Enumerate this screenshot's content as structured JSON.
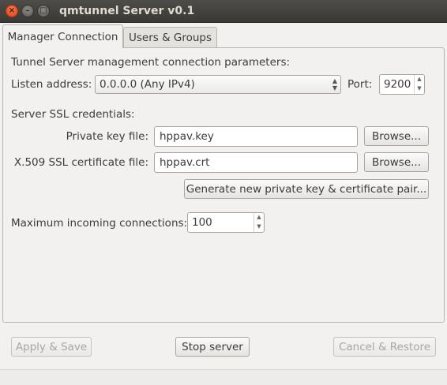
{
  "window": {
    "title": "qmtunnel Server v0.1",
    "close_glyph": "×",
    "min_glyph": "–",
    "max_glyph": "□"
  },
  "tabs": [
    {
      "label": "Manager Connection",
      "active": true
    },
    {
      "label": "Users & Groups",
      "active": false
    }
  ],
  "manager": {
    "heading": "Tunnel Server management connection parameters:",
    "listen_label": "Listen address:",
    "listen_value": "0.0.0.0 (Any IPv4)",
    "port_label": "Port:",
    "port_value": "9200",
    "ssl_heading": "Server SSL credentials:",
    "private_key_label": "Private key file:",
    "private_key_value": "hppav.key",
    "cert_label": "X.509 SSL certificate file:",
    "cert_value": "hppav.crt",
    "browse_label": "Browse...",
    "generate_label": "Generate new private key & certificate pair...",
    "max_conn_label": "Maximum incoming connections:",
    "max_conn_value": "100"
  },
  "footer": {
    "apply_label": "Apply & Save",
    "stop_label": "Stop server",
    "cancel_label": "Cancel & Restore"
  },
  "icons": {
    "up": "▲",
    "down": "▼"
  }
}
